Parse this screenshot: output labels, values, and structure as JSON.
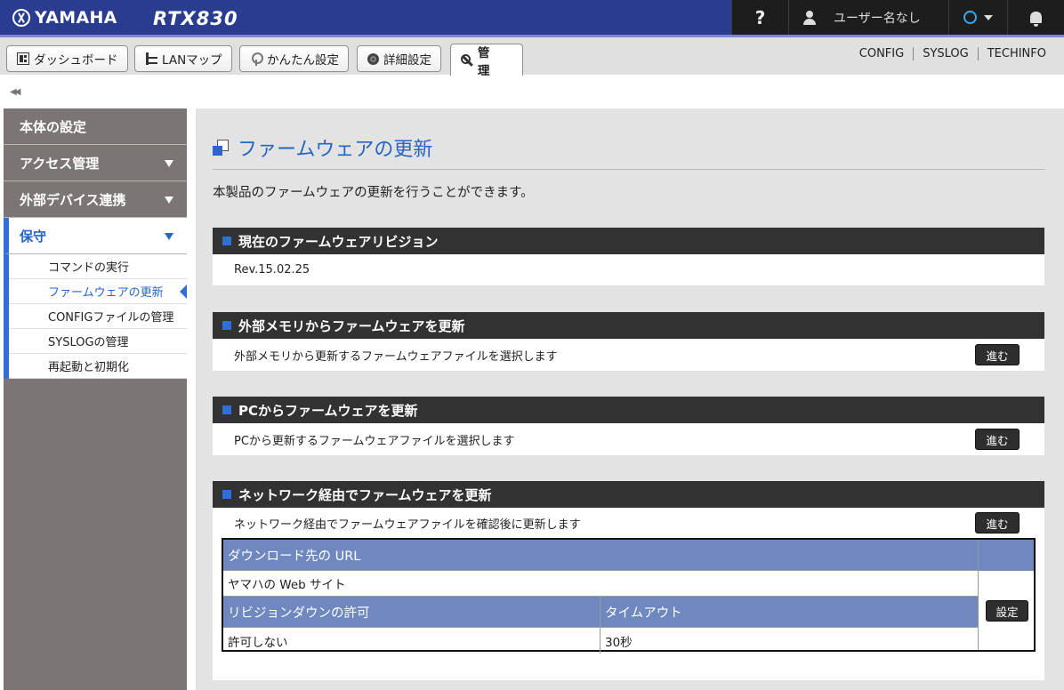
{
  "header": {
    "brand": "YAMAHA",
    "model": "RTX830",
    "help": "?",
    "user_label": "ユーザー名なし"
  },
  "toolbar": {
    "tabs": [
      {
        "label": "ダッシュボード",
        "icon": "dashboard-icon"
      },
      {
        "label": "LANマップ",
        "icon": "lan-map-icon"
      },
      {
        "label": "かんたん設定",
        "icon": "easy-setup-icon"
      },
      {
        "label": "詳細設定",
        "icon": "gear-icon"
      },
      {
        "label": "管　理",
        "icon": "wrench-icon",
        "active": true
      }
    ],
    "links": [
      "CONFIG",
      "SYSLOG",
      "TECHINFO"
    ]
  },
  "sidebar": {
    "collapse": "◀◀",
    "items": [
      {
        "label": "本体の設定"
      },
      {
        "label": "アクセス管理"
      },
      {
        "label": "外部デバイス連携"
      },
      {
        "label": "保守",
        "open": true
      }
    ],
    "sub_items": [
      "コマンドの実行",
      "ファームウェアの更新",
      "CONFIGファイルの管理",
      "SYSLOGの管理",
      "再起動と初期化"
    ]
  },
  "main": {
    "title": "ファームウェアの更新",
    "description": "本製品のファームウェアの更新を行うことができます。",
    "current": {
      "heading": "現在のファームウェアリビジョン",
      "revision": "Rev.15.02.25"
    },
    "external": {
      "heading": "外部メモリからファームウェアを更新",
      "text": "外部メモリから更新するファームウェアファイルを選択します",
      "button": "進む"
    },
    "pc": {
      "heading": "PCからファームウェアを更新",
      "text": "PCから更新するファームウェアファイルを選択します",
      "button": "進む"
    },
    "network": {
      "heading": "ネットワーク経由でファームウェアを更新",
      "text": "ネットワーク経由でファームウェアファイルを確認後に更新します",
      "button": "進む",
      "url_header": "ダウンロード先の URL",
      "url_value": "ヤマハの Web サイト",
      "revdown_header": "リビジョンダウンの許可",
      "revdown_value": "許可しない",
      "timeout_header": "タイムアウト",
      "timeout_value": "30秒",
      "set_button": "設定"
    }
  }
}
